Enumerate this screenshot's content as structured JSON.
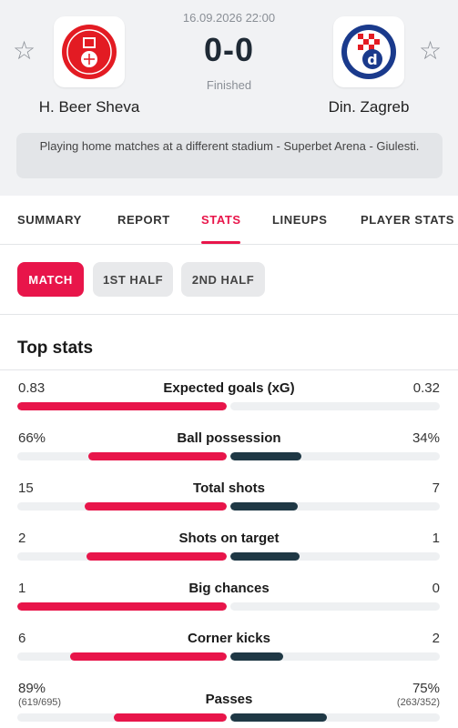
{
  "match": {
    "datetime": "16.09.2026 22:00",
    "score": "0-0",
    "status": "Finished",
    "home": {
      "name": "H. Beer Sheva",
      "color": "#e31b23"
    },
    "away": {
      "name": "Din. Zagreb",
      "color": "#1a3a8c"
    },
    "notice": "Playing home matches at a different stadium - Superbet Arena - Giulesti."
  },
  "tabs": [
    "SUMMARY",
    "REPORT",
    "STATS",
    "LINEUPS",
    "PLAYER STATS"
  ],
  "active_tab": "STATS",
  "periods": [
    "MATCH",
    "1ST HALF",
    "2ND HALF"
  ],
  "active_period": "MATCH",
  "section_title": "Top stats",
  "colors": {
    "accent": "#e8154a",
    "away_bar": "#1f3845"
  },
  "stats": [
    {
      "label": "Expected goals (xG)",
      "home": "0.83",
      "away": "0.32",
      "home_share": 1.0,
      "away_share": 0.0
    },
    {
      "label": "Ball possession",
      "home": "66%",
      "away": "34%",
      "home_share": 0.66,
      "away_share": 0.34
    },
    {
      "label": "Total shots",
      "home": "15",
      "away": "7",
      "home_share": 0.68,
      "away_share": 0.32
    },
    {
      "label": "Shots on target",
      "home": "2",
      "away": "1",
      "home_share": 0.67,
      "away_share": 0.33
    },
    {
      "label": "Big chances",
      "home": "1",
      "away": "0",
      "home_share": 1.0,
      "away_share": 0.0
    },
    {
      "label": "Corner kicks",
      "home": "6",
      "away": "2",
      "home_share": 0.75,
      "away_share": 0.25
    },
    {
      "label": "Passes",
      "home": "89%",
      "home_detail": "(619/695)",
      "away": "75%",
      "away_detail": "(263/352)",
      "home_share": 0.54,
      "away_share": 0.46
    }
  ]
}
